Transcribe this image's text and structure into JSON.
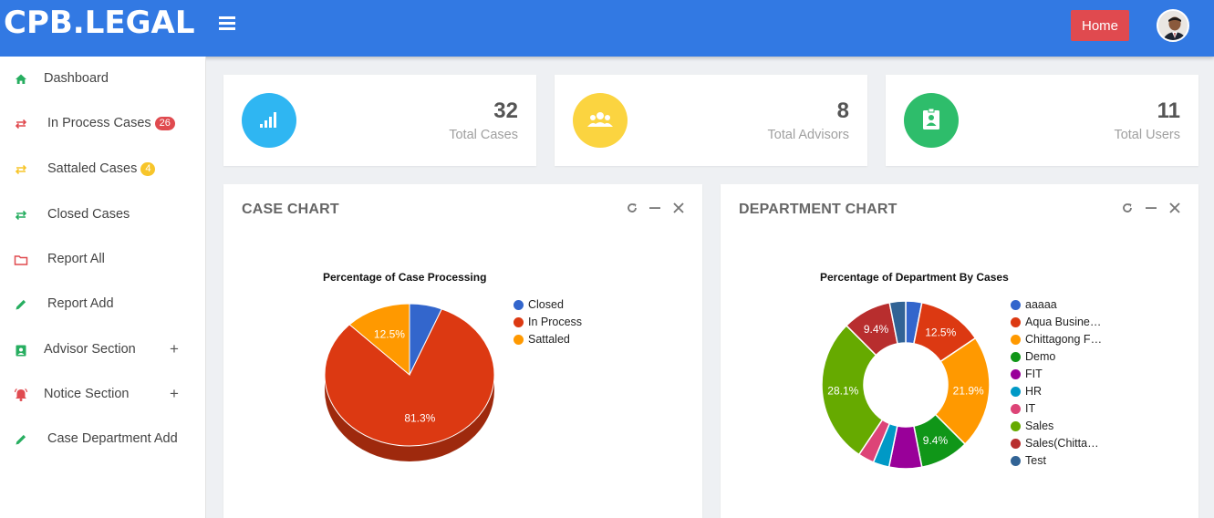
{
  "header": {
    "brand": "CPB.LEGAL",
    "home_label": "Home"
  },
  "sidebar": {
    "items": [
      {
        "label": "Dashboard",
        "icon": "home-icon",
        "color": "#27ae60"
      },
      {
        "label": "In Process Cases",
        "icon": "exchange-icon",
        "color": "#e04a4f",
        "badge": "26",
        "badge_color": "red"
      },
      {
        "label": "Sattaled Cases",
        "icon": "exchange-icon",
        "color": "#f7c52a",
        "badge": "4",
        "badge_color": "yellow"
      },
      {
        "label": "Closed Cases",
        "icon": "exchange-icon",
        "color": "#27ae60"
      },
      {
        "label": "Report All",
        "icon": "folder-icon",
        "color": "#e04a4f"
      },
      {
        "label": "Report Add",
        "icon": "pencil-icon",
        "color": "#27ae60"
      },
      {
        "label": "Advisor Section",
        "icon": "badge-icon",
        "color": "#27ae60",
        "expand": "+"
      },
      {
        "label": "Notice Section",
        "icon": "bell-icon",
        "color": "#e04a4f",
        "expand": "+"
      },
      {
        "label": "Case Department Add",
        "icon": "pencil-icon",
        "color": "#27ae60"
      }
    ]
  },
  "stats": [
    {
      "value": "32",
      "label": "Total Cases",
      "icon": "signal-icon",
      "color": "#2fb6f2"
    },
    {
      "value": "8",
      "label": "Total Advisors",
      "icon": "users-icon",
      "color": "#fbd440"
    },
    {
      "value": "11",
      "label": "Total Users",
      "icon": "id-badge-icon",
      "color": "#2ebd6b"
    }
  ],
  "case_panel": {
    "title": "CASE CHART"
  },
  "dept_panel": {
    "title": "DEPARTMENT CHART"
  },
  "chart_data": [
    {
      "type": "pie",
      "title": "Percentage of Case Processing",
      "categories": [
        "Closed",
        "In Process",
        "Sattaled"
      ],
      "values": [
        6.2,
        81.3,
        12.5
      ],
      "colors": [
        "#3366cc",
        "#dc3912",
        "#ff9900"
      ],
      "data_labels": [
        "",
        "81.3%",
        "12.5%"
      ],
      "legend": "right",
      "style": "3d"
    },
    {
      "type": "pie",
      "title": "Percentage of Department By Cases",
      "categories": [
        "aaaaa",
        "Aqua Busine…",
        "Chittagong F…",
        "Demo",
        "FIT",
        "HR",
        "IT",
        "Sales",
        "Sales(Chitta…",
        "Test"
      ],
      "values": [
        3.1,
        12.5,
        21.9,
        9.4,
        6.3,
        3.1,
        3.1,
        28.1,
        9.4,
        3.1
      ],
      "colors": [
        "#3366cc",
        "#dc3912",
        "#ff9900",
        "#109618",
        "#990099",
        "#0099c6",
        "#dd4477",
        "#66aa00",
        "#b82e2e",
        "#316395"
      ],
      "data_labels": [
        "",
        "12.5%",
        "21.9%",
        "9.4%",
        "",
        "",
        "",
        "28.1%",
        "9.4%",
        ""
      ],
      "legend": "right",
      "style": "donut"
    }
  ]
}
